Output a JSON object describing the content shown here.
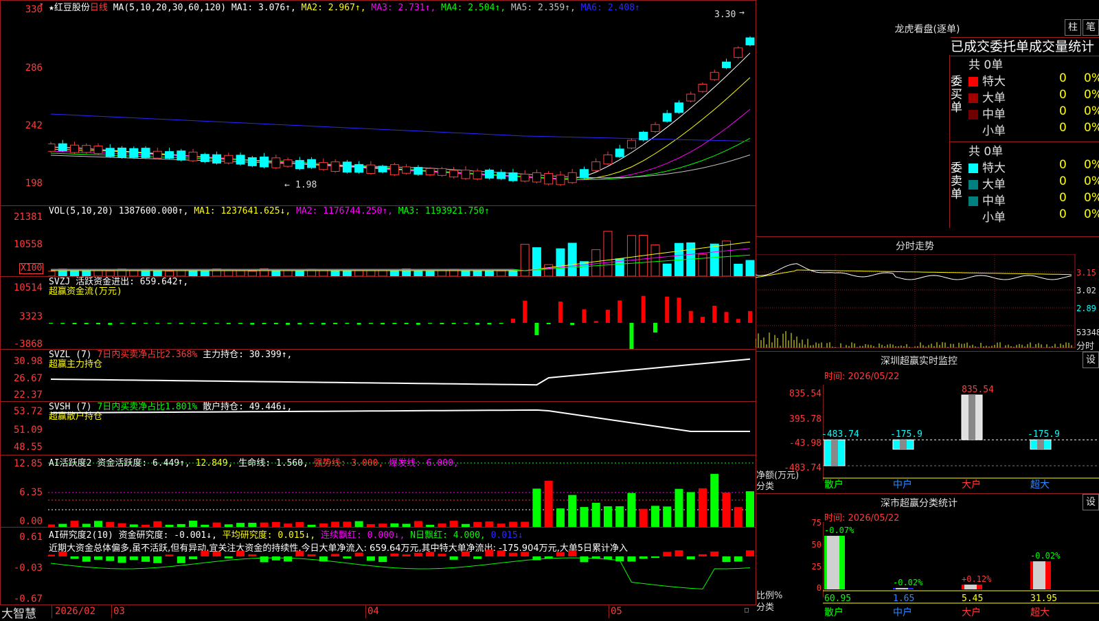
{
  "stock": {
    "star": "★",
    "name": "红豆股份",
    "period": "日线"
  },
  "ma_header": {
    "label": "MA(5,10,20,30,60,120)",
    "items": [
      {
        "text": "MA1: 3.076↑,",
        "color": "#ffffff"
      },
      {
        "text": "MA2: 2.967↑,",
        "color": "#ffff00"
      },
      {
        "text": "MA3: 2.731↑,",
        "color": "#ff00ff"
      },
      {
        "text": "MA4: 2.504↑,",
        "color": "#00ff00"
      },
      {
        "text": "MA5: 2.359↑,",
        "color": "#c0c0c0"
      },
      {
        "text": "MA6: 2.408↑",
        "color": "#2a2aff"
      }
    ]
  },
  "price_axis": [
    "330",
    "286",
    "242",
    "198"
  ],
  "price_max_label": "3.30",
  "price_min_label": "1.98",
  "vol": {
    "label": "VOL(5,10,20)",
    "value": "1387600.000↑,",
    "items": [
      {
        "text": "MA1: 1237641.625↓,",
        "color": "#ffff00"
      },
      {
        "text": "MA2: 1176744.250↑,",
        "color": "#ff00ff"
      },
      {
        "text": "MA3: 1193921.750↑",
        "color": "#00ff00"
      }
    ],
    "axis": [
      "21381",
      "10558"
    ],
    "unit": "X100"
  },
  "svzj": {
    "label": "SVZJ",
    "line1": "活跃资金进出: 659.642↑,",
    "line2": "超赢资金流(万元)",
    "axis": [
      "10514",
      "3323",
      "-3868"
    ]
  },
  "svzl": {
    "label": "SVZL (7)",
    "pct": "7日内买卖净占比2.368%",
    "hold": "主力持仓: 30.399↑,",
    "line2": "超赢主力持仓",
    "axis": [
      "30.98",
      "26.67",
      "22.37"
    ]
  },
  "svsh": {
    "label": "SVSH (7)",
    "pct": "7日内买卖净占比1.801%",
    "hold": "散户持仓: 49.446↓,",
    "line2": "超赢散户持仓",
    "axis": [
      "53.72",
      "51.09",
      "48.55"
    ]
  },
  "ai1": {
    "label": "AI活跃度2",
    "a": "资金活跃度: 6.449↑,",
    "b": "12.849,",
    "c": "生命线: 1.560,",
    "d": "强势线: 3.000,",
    "e": "爆发线: 6.000,",
    "axis": [
      "12.85",
      "6.35",
      "0.00"
    ]
  },
  "ai2": {
    "label": "AI研究度2(10)",
    "a": "资金研究度: -0.001↓,",
    "b": "平均研究度: 0.015↓,",
    "c": "连续飘红: 0.000↓,",
    "d": "N日飘红: 4.000,",
    "e": "0.015↓",
    "text": "近期大资金总体偏多,虽不活跃,但有异动,宜关注大资金的持续性,今日大单净流入: 659.64万元,其中特大单净流出: -175.904万元,大单5日累计净入",
    "axis": [
      "0.61",
      "-0.03",
      "-0.67"
    ]
  },
  "bottom_bar": {
    "brand": "大智慧",
    "dates": [
      "2026/02",
      "03",
      "04",
      "05"
    ]
  },
  "right": {
    "dragon_title": "龙虎看盘(逐单)",
    "btn_zhu": "柱",
    "btn_bi": "笔",
    "tabs_text": "已成交委托单成交量统计",
    "buy_side": "委买单",
    "sell_side": "委卖单",
    "buy_total": "共 0单",
    "sell_total": "共 0单",
    "buy_rows": [
      {
        "label": "特大",
        "count": "0",
        "pct": "0%",
        "color": "#ff0000"
      },
      {
        "label": "大单",
        "count": "0",
        "pct": "0%",
        "color": "#a00000"
      },
      {
        "label": "中单",
        "count": "0",
        "pct": "0%",
        "color": "#700000"
      },
      {
        "label": "小单",
        "count": "0",
        "pct": "0%",
        "color": ""
      }
    ],
    "sell_rows": [
      {
        "label": "特大",
        "count": "0",
        "pct": "0%",
        "color": "#00ffff"
      },
      {
        "label": "大单",
        "count": "0",
        "pct": "0%",
        "color": "#008080"
      },
      {
        "label": "中单",
        "count": "0",
        "pct": "0%",
        "color": "#008080"
      },
      {
        "label": "小单",
        "count": "0",
        "pct": "0%",
        "color": ""
      }
    ],
    "minute_title": "分时走势",
    "minute_axis": [
      "3.15",
      "3.02",
      "2.89"
    ],
    "minute_vol": "53348",
    "minute_label": "分时",
    "sz_title": "深圳超赢实时监控",
    "sz_btn": "设",
    "sz_time": "时间: 2026/05/22",
    "sz_axis": [
      "835.54",
      "395.78",
      "-43.98",
      "-483.74"
    ],
    "sz_bars": [
      {
        "cat": "散户",
        "value": -483.74,
        "label": "-483.74"
      },
      {
        "cat": "中户",
        "value": -175.9,
        "label": "-175.9"
      },
      {
        "cat": "大户",
        "value": 835.54,
        "label": "835.54"
      },
      {
        "cat": "超大",
        "value": -175.9,
        "label": "-175.9"
      }
    ],
    "sz_ylabel": "净额(万元)",
    "sz_xlabel": "分类",
    "sh_title": "深市超赢分类统计",
    "sh_btn": "设",
    "sh_time": "时间: 2026/05/22",
    "sh_axis": [
      "75",
      "50",
      "25",
      "0"
    ],
    "sh_bars": [
      {
        "cat": "散户",
        "value": 60.95,
        "pct": "-0.07%",
        "pct_color": "#00ff00"
      },
      {
        "cat": "中户",
        "value": 1.65,
        "pct": "-0.02%",
        "pct_color": "#00ff00"
      },
      {
        "cat": "大户",
        "value": 5.45,
        "pct": "+0.12%",
        "pct_color": "#ff3b3b"
      },
      {
        "cat": "超大",
        "value": 31.95,
        "pct": "-0.02%",
        "pct_color": "#00ff00"
      }
    ],
    "sh_ylabel": "比例%",
    "sh_xlabel": "分类"
  },
  "colors": {
    "up": "#ff3b3b",
    "down": "#00ffff",
    "grid": "#9c1d1d"
  }
}
